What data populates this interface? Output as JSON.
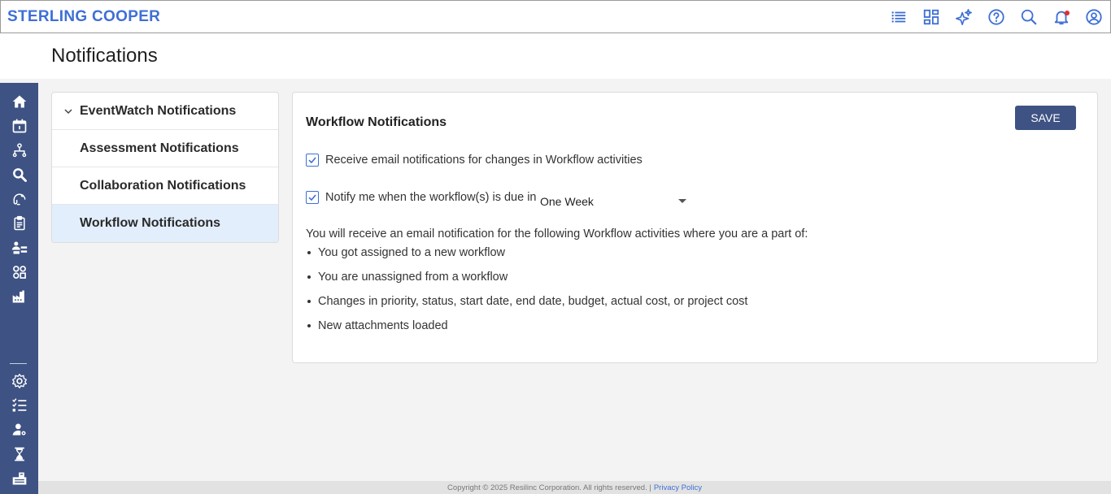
{
  "header": {
    "brand": "STERLING COOPER",
    "icons": [
      "list-icon",
      "dashboard-icon",
      "ai-sparkle-icon",
      "help-icon",
      "search-icon",
      "bell-icon",
      "user-icon"
    ]
  },
  "page": {
    "title": "Notifications"
  },
  "rail": {
    "icons": [
      "home-icon",
      "calendar-icon",
      "network-icon",
      "search-doc-icon",
      "headset-icon",
      "clipboard-icon",
      "people-icon",
      "apps-icon",
      "factory-icon",
      "settings-icon",
      "checklist-icon",
      "user-settings-icon",
      "hourglass-icon",
      "building-icon"
    ]
  },
  "menu": {
    "items": [
      {
        "label": "EventWatch Notifications",
        "expanded": true
      },
      {
        "label": "Assessment Notifications"
      },
      {
        "label": "Collaboration Notifications"
      },
      {
        "label": "Workflow Notifications",
        "active": true
      }
    ]
  },
  "content": {
    "title": "Workflow Notifications",
    "save_label": "SAVE",
    "option1_label": "Receive email notifications for changes in Workflow activities",
    "option1_checked": true,
    "option2_label": "Notify me when the workflow(s) is due in",
    "option2_checked": true,
    "due_select_value": "One Week",
    "intro": "You will receive an email notification for the following Workflow activities where you are a part of:",
    "bullets": [
      "You got assigned to a new workflow",
      "You are unassigned from a workflow",
      "Changes in priority, status, start date, end date, budget, actual cost, or project cost",
      "New attachments loaded"
    ]
  },
  "footer": {
    "copyright": "Copyright © 2025 Resilinc Corporation. All rights reserved. |",
    "privacy": "Privacy Policy"
  },
  "colors": {
    "accent": "#3f6fd6",
    "rail": "#3e5283",
    "active_bg": "#e3eefc"
  }
}
